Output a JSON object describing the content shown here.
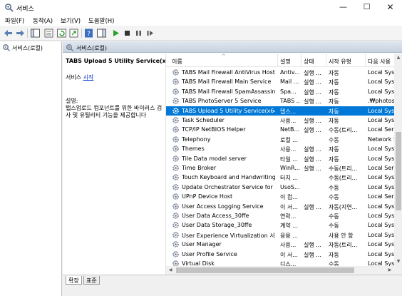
{
  "window": {
    "title": "서비스",
    "icon": "services-gear-icon"
  },
  "menu": [
    "파일(F)",
    "동작(A)",
    "보기(V)",
    "도움말(H)"
  ],
  "toolbar": {
    "buttons": [
      "back-arrow-icon",
      "forward-arrow-icon",
      "show-tree-icon",
      "properties-icon",
      "refresh-icon",
      "export-list-icon",
      "help-icon",
      "show-action-pane-icon",
      "start-service-icon",
      "stop-service-icon",
      "pause-service-icon",
      "restart-service-icon"
    ],
    "colors": {
      "start": "#2e9e2e",
      "stop": "#333333"
    }
  },
  "tree": {
    "root_label": "서비스(로컬)"
  },
  "pane_header": "서비스(로컬)",
  "details": {
    "service_name": "TABS Upload 5 Utility Service(x64)",
    "start_prefix": "서비스 ",
    "start_link": "시작",
    "desc_label": "설명:",
    "description": "탭스업로드 컴포넌트를 위한 바이러스 검사 및 유틸리티 기능을 제공합니다"
  },
  "columns": [
    "이름",
    "설명",
    "상태",
    "시작 유형",
    "다음 사용"
  ],
  "services": [
    {
      "name": "TABS Mail Firewall AntiVirus Host...",
      "desc": "Antiv...",
      "status": "실행 ...",
      "startup": "자동",
      "logon": "Local Syst"
    },
    {
      "name": "TABS Mail Firewall Main Service",
      "desc": "Mail ...",
      "status": "실행 ...",
      "startup": "자동",
      "logon": "Local Syst"
    },
    {
      "name": "TABS Mail Firewall SpamAssassin...",
      "desc": "Spa...",
      "status": "실행 ...",
      "startup": "자동",
      "logon": "Local Syst"
    },
    {
      "name": "TABS PhotoServer 5 Service",
      "desc": "TABS ...",
      "status": "실행 ...",
      "startup": "자동",
      "logon": ".₩photos"
    },
    {
      "name": "TABS Upload 5 Utility Service(x64)",
      "desc": "탭스...",
      "status": "",
      "startup": "자동",
      "logon": "Local Syst",
      "selected": true
    },
    {
      "name": "Task Scheduler",
      "desc": "사용...",
      "status": "실행 ...",
      "startup": "자동",
      "logon": "Local Syst"
    },
    {
      "name": "TCP/IP NetBIOS Helper",
      "desc": "NetB...",
      "status": "실행 ...",
      "startup": "수동(트리...",
      "logon": "Local Serv"
    },
    {
      "name": "Telephony",
      "desc": "로컬 ...",
      "status": "",
      "startup": "수동",
      "logon": "Network S"
    },
    {
      "name": "Themes",
      "desc": "사용...",
      "status": "실행 ...",
      "startup": "자동",
      "logon": "Local Syst"
    },
    {
      "name": "Tile Data model server",
      "desc": "타일 ...",
      "status": "실행 ...",
      "startup": "자동",
      "logon": "Local Syst"
    },
    {
      "name": "Time Broker",
      "desc": "WinR...",
      "status": "실행 ...",
      "startup": "수동(트리...",
      "logon": "Local Serv"
    },
    {
      "name": "Touch Keyboard and Handwriting...",
      "desc": "터치 ...",
      "status": "",
      "startup": "수동(트리...",
      "logon": "Local Syst"
    },
    {
      "name": "Update Orchestrator Service for ...",
      "desc": "UsoS...",
      "status": "",
      "startup": "수동",
      "logon": "Local Syst"
    },
    {
      "name": "UPnP Device Host",
      "desc": "이 컴...",
      "status": "",
      "startup": "수동",
      "logon": "Local Serv"
    },
    {
      "name": "User Access Logging Service",
      "desc": "이 서...",
      "status": "실행 ...",
      "startup": "자동(지연...",
      "logon": "Local Syst"
    },
    {
      "name": "User Data Access_30ffe",
      "desc": "연락...",
      "status": "",
      "startup": "수동",
      "logon": "Local Syst"
    },
    {
      "name": "User Data Storage_30ffe",
      "desc": "계약 ...",
      "status": "",
      "startup": "수동",
      "logon": "Local Syst"
    },
    {
      "name": "User Experience Virtualization 서...",
      "desc": "응용 ...",
      "status": "",
      "startup": "사용 안 함",
      "logon": "Local Syst"
    },
    {
      "name": "User Manager",
      "desc": "사용...",
      "status": "실행 ...",
      "startup": "자동(트리...",
      "logon": "Local Syst"
    },
    {
      "name": "User Profile Service",
      "desc": "이 서...",
      "status": "실행 ...",
      "startup": "자동",
      "logon": "Local Syst"
    },
    {
      "name": "Virtual Disk",
      "desc": "디스...",
      "status": "",
      "startup": "수동",
      "logon": "Local Syst"
    }
  ],
  "tabs": [
    "확장",
    "표준"
  ],
  "colors": {
    "selection": "#0078d7",
    "link": "#0033cc"
  }
}
